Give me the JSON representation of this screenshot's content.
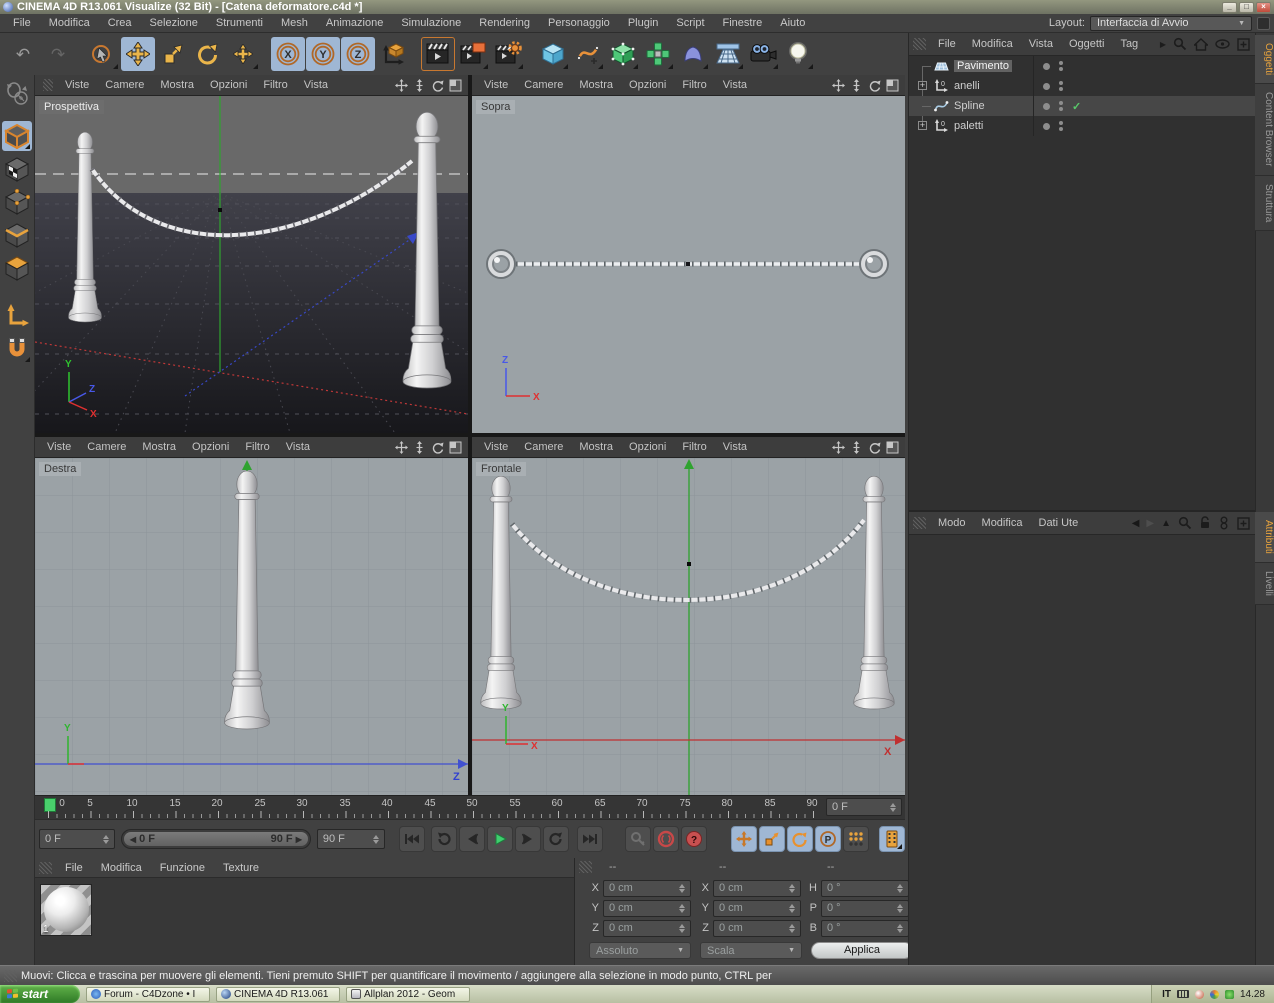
{
  "window": {
    "title": "CINEMA 4D R13.061 Visualize (32 Bit) - [Catena deformatore.c4d *]",
    "controls": {
      "minimize": "_",
      "restore": "□",
      "close": "×"
    }
  },
  "menu_bar": {
    "items": [
      "File",
      "Modifica",
      "Crea",
      "Selezione",
      "Strumenti",
      "Mesh",
      "Animazione",
      "Simulazione",
      "Rendering",
      "Personaggio",
      "Plugin",
      "Script",
      "Finestre",
      "Aiuto"
    ],
    "layout_label": "Layout:",
    "layout_value": "Interfaccia di Avvio"
  },
  "toolbar": {
    "axis": [
      "X",
      "Y",
      "Z"
    ]
  },
  "viewport_menu": [
    "Viste",
    "Camere",
    "Mostra",
    "Opzioni",
    "Filtro",
    "Vista"
  ],
  "viewports": {
    "perspective": {
      "label": "Prospettiva",
      "axis_x": "X",
      "axis_y": "Y",
      "axis_z": "Z"
    },
    "top": {
      "label": "Sopra",
      "axis_x": "X",
      "axis_z": "Z"
    },
    "right": {
      "label": "Destra",
      "axis_y": "Y",
      "axis_z": "Z"
    },
    "front": {
      "label": "Frontale",
      "axis_x": "X",
      "axis_y": "Y"
    }
  },
  "object_manager": {
    "menu": [
      "File",
      "Modifica",
      "Vista",
      "Oggetti",
      "Tag"
    ],
    "objects": [
      {
        "name": "Pavimento"
      },
      {
        "name": "anelli"
      },
      {
        "name": "Spline"
      },
      {
        "name": "paletti"
      }
    ],
    "side_tabs": [
      "Oggetti",
      "Content Browser",
      "Struttura"
    ]
  },
  "attribute_manager": {
    "menu": [
      "Modo",
      "Modifica",
      "Dati Ute"
    ],
    "side_tabs": [
      "Attributi",
      "Livelli"
    ]
  },
  "timeline": {
    "ticks": [
      "0",
      "5",
      "10",
      "15",
      "20",
      "25",
      "30",
      "35",
      "40",
      "45",
      "50",
      "55",
      "60",
      "65",
      "70",
      "75",
      "80",
      "85",
      "90"
    ],
    "ruler_field": "0 F",
    "current_field": "0 F",
    "range_start": "0 F",
    "range_end": "90 F",
    "end_field": "90 F"
  },
  "material_manager": {
    "menu": [
      "File",
      "Modifica",
      "Funzione",
      "Texture"
    ],
    "material_label": "1"
  },
  "coordinates": {
    "headers": [
      "--",
      "--",
      "--"
    ],
    "position": {
      "x_label": "X",
      "x": "0 cm",
      "y_label": "Y",
      "y": "0 cm",
      "z_label": "Z",
      "z": "0 cm",
      "mode": "Assoluto"
    },
    "scale": {
      "x_label": "X",
      "x": "0 cm",
      "y_label": "Y",
      "y": "0 cm",
      "z_label": "Z",
      "z": "0 cm",
      "mode": "Scala"
    },
    "rotation": {
      "h_label": "H",
      "h": "0 °",
      "p_label": "P",
      "p": "0 °",
      "b_label": "B",
      "b": "0 °"
    },
    "apply_label": "Applica"
  },
  "status_bar": "Muovi: Clicca e trascina per muovere gli elementi. Tieni premuto SHIFT per quantificare il movimento / aggiungere alla selezione in modo punto, CTRL per",
  "taskbar": {
    "start_label": "start",
    "tasks": [
      "Forum - C4Dzone • I",
      "CINEMA 4D R13.061",
      "Allplan 2012 - Geom"
    ],
    "tray_lang": "IT",
    "tray_time": "14.28"
  },
  "icons": {
    "undo": "↶",
    "redo": "↷",
    "expand": "+",
    "check": "✓",
    "dropdown": "▼",
    "menu_arrow": "▶",
    "back": "◀",
    "forward": "▶",
    "up": "▲",
    "range_left": "◀",
    "range_right": "▶",
    "p_key": "P"
  },
  "colors": {
    "accent_orange": "#e8a33d",
    "active_blue": "#9fb7d4",
    "play_green": "#3ecf6e",
    "record_red": "#c84848"
  }
}
